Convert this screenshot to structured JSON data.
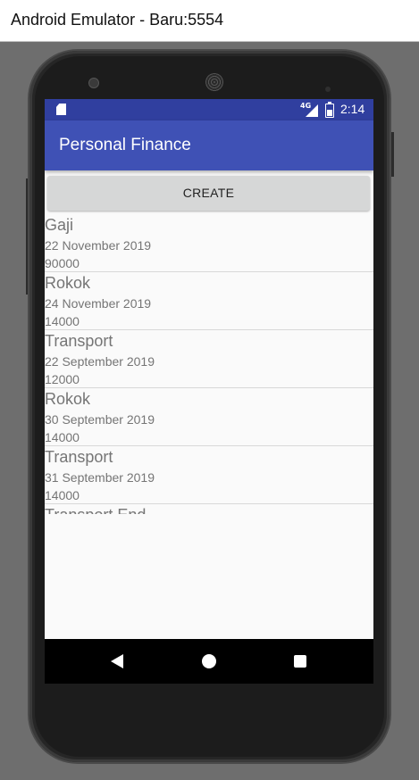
{
  "window": {
    "title": "Android Emulator - Baru:5554"
  },
  "status_bar": {
    "network": "4G",
    "time": "2:14"
  },
  "app_bar": {
    "title": "Personal Finance"
  },
  "actions": {
    "create_label": "CREATE"
  },
  "transactions": [
    {
      "title": "Gaji",
      "date": "22 November 2019",
      "amount": "90000"
    },
    {
      "title": "Rokok",
      "date": "24 November 2019",
      "amount": "14000"
    },
    {
      "title": "Transport",
      "date": "22 September 2019",
      "amount": "12000"
    },
    {
      "title": "Rokok",
      "date": "30 September 2019",
      "amount": "14000"
    },
    {
      "title": "Transport",
      "date": "31 September 2019",
      "amount": "14000"
    },
    {
      "title": "Transport End",
      "date": "",
      "amount": ""
    }
  ],
  "icons": {
    "sd_card": "sd-card-icon",
    "signal": "signal-icon",
    "battery": "battery-icon",
    "back": "back-icon",
    "home": "home-icon",
    "recents": "recents-icon"
  },
  "colors": {
    "status_bar": "#303f9f",
    "app_bar": "#3f51b5",
    "button": "#d6d7d7",
    "list_text": "#757575"
  }
}
